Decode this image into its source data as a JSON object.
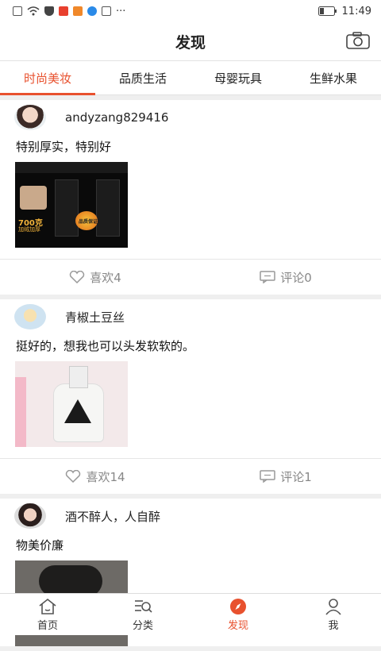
{
  "status_bar": {
    "time": "11:49",
    "dots": "···"
  },
  "header": {
    "title": "发现",
    "camera_icon": "camera-icon"
  },
  "tabs": [
    {
      "label": "时尚美妆",
      "active": true
    },
    {
      "label": "品质生活",
      "active": false
    },
    {
      "label": "母婴玩具",
      "active": false
    },
    {
      "label": "生鲜水果",
      "active": false
    }
  ],
  "posts": [
    {
      "username": "andyzang829416",
      "text": "特别厚实，特别好",
      "image_label": "700克",
      "image_sub": "加绒加厚",
      "badge": "品质保证",
      "likes": "喜欢4",
      "comments": "评论0"
    },
    {
      "username": "青椒土豆丝",
      "text": "挺好的，想我也可以头发软软的。",
      "likes": "喜欢14",
      "comments": "评论1"
    },
    {
      "username": "酒不醉人，人自醉",
      "text": "物美价廉"
    }
  ],
  "bottom_nav": [
    {
      "label": "首页",
      "icon": "home-icon",
      "active": false
    },
    {
      "label": "分类",
      "icon": "category-search-icon",
      "active": false
    },
    {
      "label": "发现",
      "icon": "compass-icon",
      "active": true
    },
    {
      "label": "我",
      "icon": "user-icon",
      "active": false
    }
  ],
  "colors": {
    "accent": "#e8512e",
    "muted": "#888888"
  }
}
